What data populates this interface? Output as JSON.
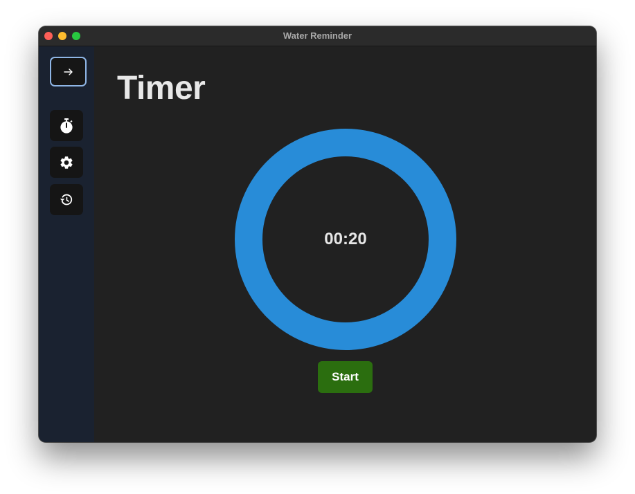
{
  "window": {
    "title": "Water Reminder"
  },
  "sidebar": {
    "toggle_icon": "arrow-right-icon",
    "items": [
      {
        "name": "timer",
        "icon": "stopwatch-icon"
      },
      {
        "name": "settings",
        "icon": "gear-icon"
      },
      {
        "name": "history",
        "icon": "history-icon"
      }
    ]
  },
  "main": {
    "title": "Timer",
    "timer": {
      "display": "00:20",
      "ring_color": "#288cd8",
      "progress": 1.0
    },
    "start_label": "Start",
    "start_color": "#2b6e0f"
  }
}
